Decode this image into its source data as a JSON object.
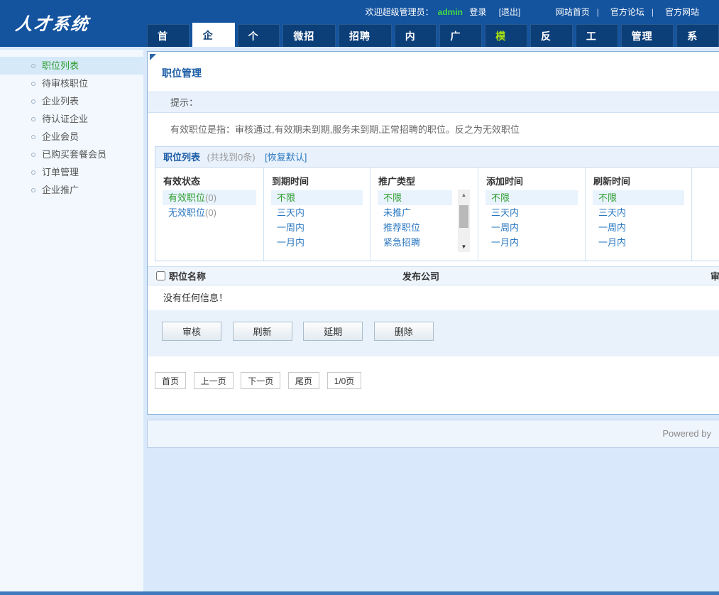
{
  "header": {
    "logo": "人才系统",
    "welcome": {
      "prefix": "欢迎超级管理员：",
      "username": "admin",
      "login": "登录",
      "logout": "[退出]"
    },
    "separator": "|",
    "links": [
      {
        "label": "网站首页"
      },
      {
        "label": "官方论坛"
      },
      {
        "label": "官方网站"
      }
    ],
    "tabs": [
      {
        "label": "首页",
        "state": "normal"
      },
      {
        "label": "企业",
        "state": "active"
      },
      {
        "label": "个人",
        "state": "normal"
      },
      {
        "label": "微招聘",
        "state": "normal"
      },
      {
        "label": "招聘会",
        "state": "normal"
      },
      {
        "label": "内容",
        "state": "normal"
      },
      {
        "label": "广告",
        "state": "normal"
      },
      {
        "label": "模板",
        "state": "hover"
      },
      {
        "label": "反馈",
        "state": "normal"
      },
      {
        "label": "工具",
        "state": "normal"
      },
      {
        "label": "管理员",
        "state": "normal"
      },
      {
        "label": "系统",
        "state": "normal"
      }
    ]
  },
  "sidebar": {
    "items": [
      {
        "label": "职位列表",
        "active": true
      },
      {
        "label": "待审核职位",
        "active": false
      },
      {
        "label": "企业列表",
        "active": false
      },
      {
        "label": "待认证企业",
        "active": false
      },
      {
        "label": "企业会员",
        "active": false
      },
      {
        "label": "已购买套餐会员",
        "active": false
      },
      {
        "label": "订单管理",
        "active": false
      },
      {
        "label": "企业推广",
        "active": false
      }
    ]
  },
  "main": {
    "title": "职位管理",
    "tip_label": "提示：",
    "tip_text": "有效职位是指：审核通过,有效期未到期,服务未到期,正常招聘的职位。反之为无效职位",
    "list_header": {
      "title": "职位列表",
      "count": "(共找到0条)",
      "reset": "[恢复默认]"
    },
    "filters": [
      {
        "name": "有效状态",
        "options": [
          {
            "text": "有效职位",
            "count": "(0)",
            "selected": true
          },
          {
            "text": "无效职位",
            "count": "(0)",
            "selected": false
          }
        ]
      },
      {
        "name": "到期时间",
        "options": [
          {
            "text": "不限",
            "selected": true
          },
          {
            "text": "三天内",
            "selected": false
          },
          {
            "text": "一周内",
            "selected": false
          },
          {
            "text": "一月内",
            "selected": false
          }
        ]
      },
      {
        "name": "推广类型",
        "has_scrollbar": true,
        "options": [
          {
            "text": "不限",
            "selected": true
          },
          {
            "text": "未推广",
            "selected": false
          },
          {
            "text": "推荐职位",
            "selected": false
          },
          {
            "text": "紧急招聘",
            "selected": false
          }
        ]
      },
      {
        "name": "添加时间",
        "options": [
          {
            "text": "不限",
            "selected": true
          },
          {
            "text": "三天内",
            "selected": false
          },
          {
            "text": "一周内",
            "selected": false
          },
          {
            "text": "一月内",
            "selected": false
          }
        ]
      },
      {
        "name": "刷新时间",
        "options": [
          {
            "text": "不限",
            "selected": true
          },
          {
            "text": "三天内",
            "selected": false
          },
          {
            "text": "一周内",
            "selected": false
          },
          {
            "text": "一月内",
            "selected": false
          }
        ]
      }
    ],
    "table": {
      "col_name": "职位名称",
      "col_company": "发布公司",
      "col_audit": "审核",
      "empty_message": "没有任何信息！"
    },
    "actions": [
      {
        "label": "审核"
      },
      {
        "label": "刷新"
      },
      {
        "label": "延期"
      },
      {
        "label": "删除"
      }
    ],
    "pagination": [
      {
        "label": "首页"
      },
      {
        "label": "上一页"
      },
      {
        "label": "下一页"
      },
      {
        "label": "尾页"
      },
      {
        "label": "1/0页"
      }
    ]
  },
  "footer": {
    "powered_by": "Powered by"
  },
  "colors": {
    "header_bg": "#14539e",
    "tab_bg": "#0c3e78",
    "tab_hover_text": "#a8e010",
    "accent_blue": "#1a5ca5",
    "link_blue": "#2a77c0",
    "selected_green": "#2f9e2f",
    "username_green": "#44dd44",
    "highlight_row": "#e9f3fd",
    "sidebar_active_bg": "#d5e9f9",
    "page_bg": "#d9e9fb"
  }
}
